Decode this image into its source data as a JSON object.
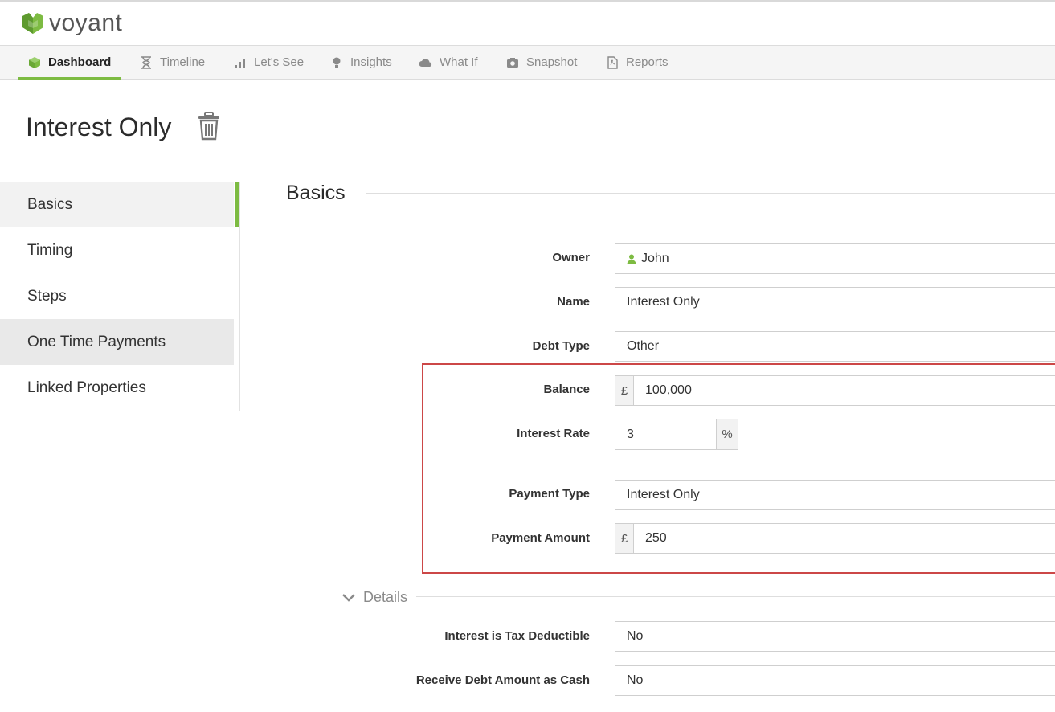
{
  "app": {
    "name": "voyant"
  },
  "nav": {
    "items": [
      {
        "label": "Dashboard",
        "icon": "cube-icon"
      },
      {
        "label": "Timeline",
        "icon": "hourglass-icon"
      },
      {
        "label": "Let's See",
        "icon": "bar-chart-icon"
      },
      {
        "label": "Insights",
        "icon": "lightbulb-icon"
      },
      {
        "label": "What If",
        "icon": "cloud-icon"
      },
      {
        "label": "Snapshot",
        "icon": "camera-icon"
      },
      {
        "label": "Reports",
        "icon": "pdf-file-icon"
      }
    ],
    "active": "Dashboard"
  },
  "page": {
    "title": "Interest Only"
  },
  "sidebar": {
    "items": [
      {
        "label": "Basics"
      },
      {
        "label": "Timing"
      },
      {
        "label": "Steps"
      },
      {
        "label": "One Time Payments"
      },
      {
        "label": "Linked Properties"
      }
    ],
    "active": "Basics"
  },
  "section": {
    "title": "Basics"
  },
  "form": {
    "owner": {
      "label": "Owner",
      "value": "John"
    },
    "name": {
      "label": "Name",
      "value": "Interest Only"
    },
    "debt_type": {
      "label": "Debt Type",
      "value": "Other"
    },
    "balance": {
      "label": "Balance",
      "currency": "£",
      "value": "100,000"
    },
    "interest_rate": {
      "label": "Interest Rate",
      "value": "3",
      "unit": "%"
    },
    "payment_type": {
      "label": "Payment Type",
      "value": "Interest Only"
    },
    "payment_amount": {
      "label": "Payment Amount",
      "currency": "£",
      "value": "250"
    }
  },
  "details": {
    "title": "Details",
    "tax_deductible": {
      "label": "Interest is Tax Deductible",
      "value": "No"
    },
    "receive_cash": {
      "label": "Receive Debt Amount as Cash",
      "value": "No"
    }
  },
  "colors": {
    "accent": "#7dbb42",
    "highlight_border": "#cc4747"
  }
}
